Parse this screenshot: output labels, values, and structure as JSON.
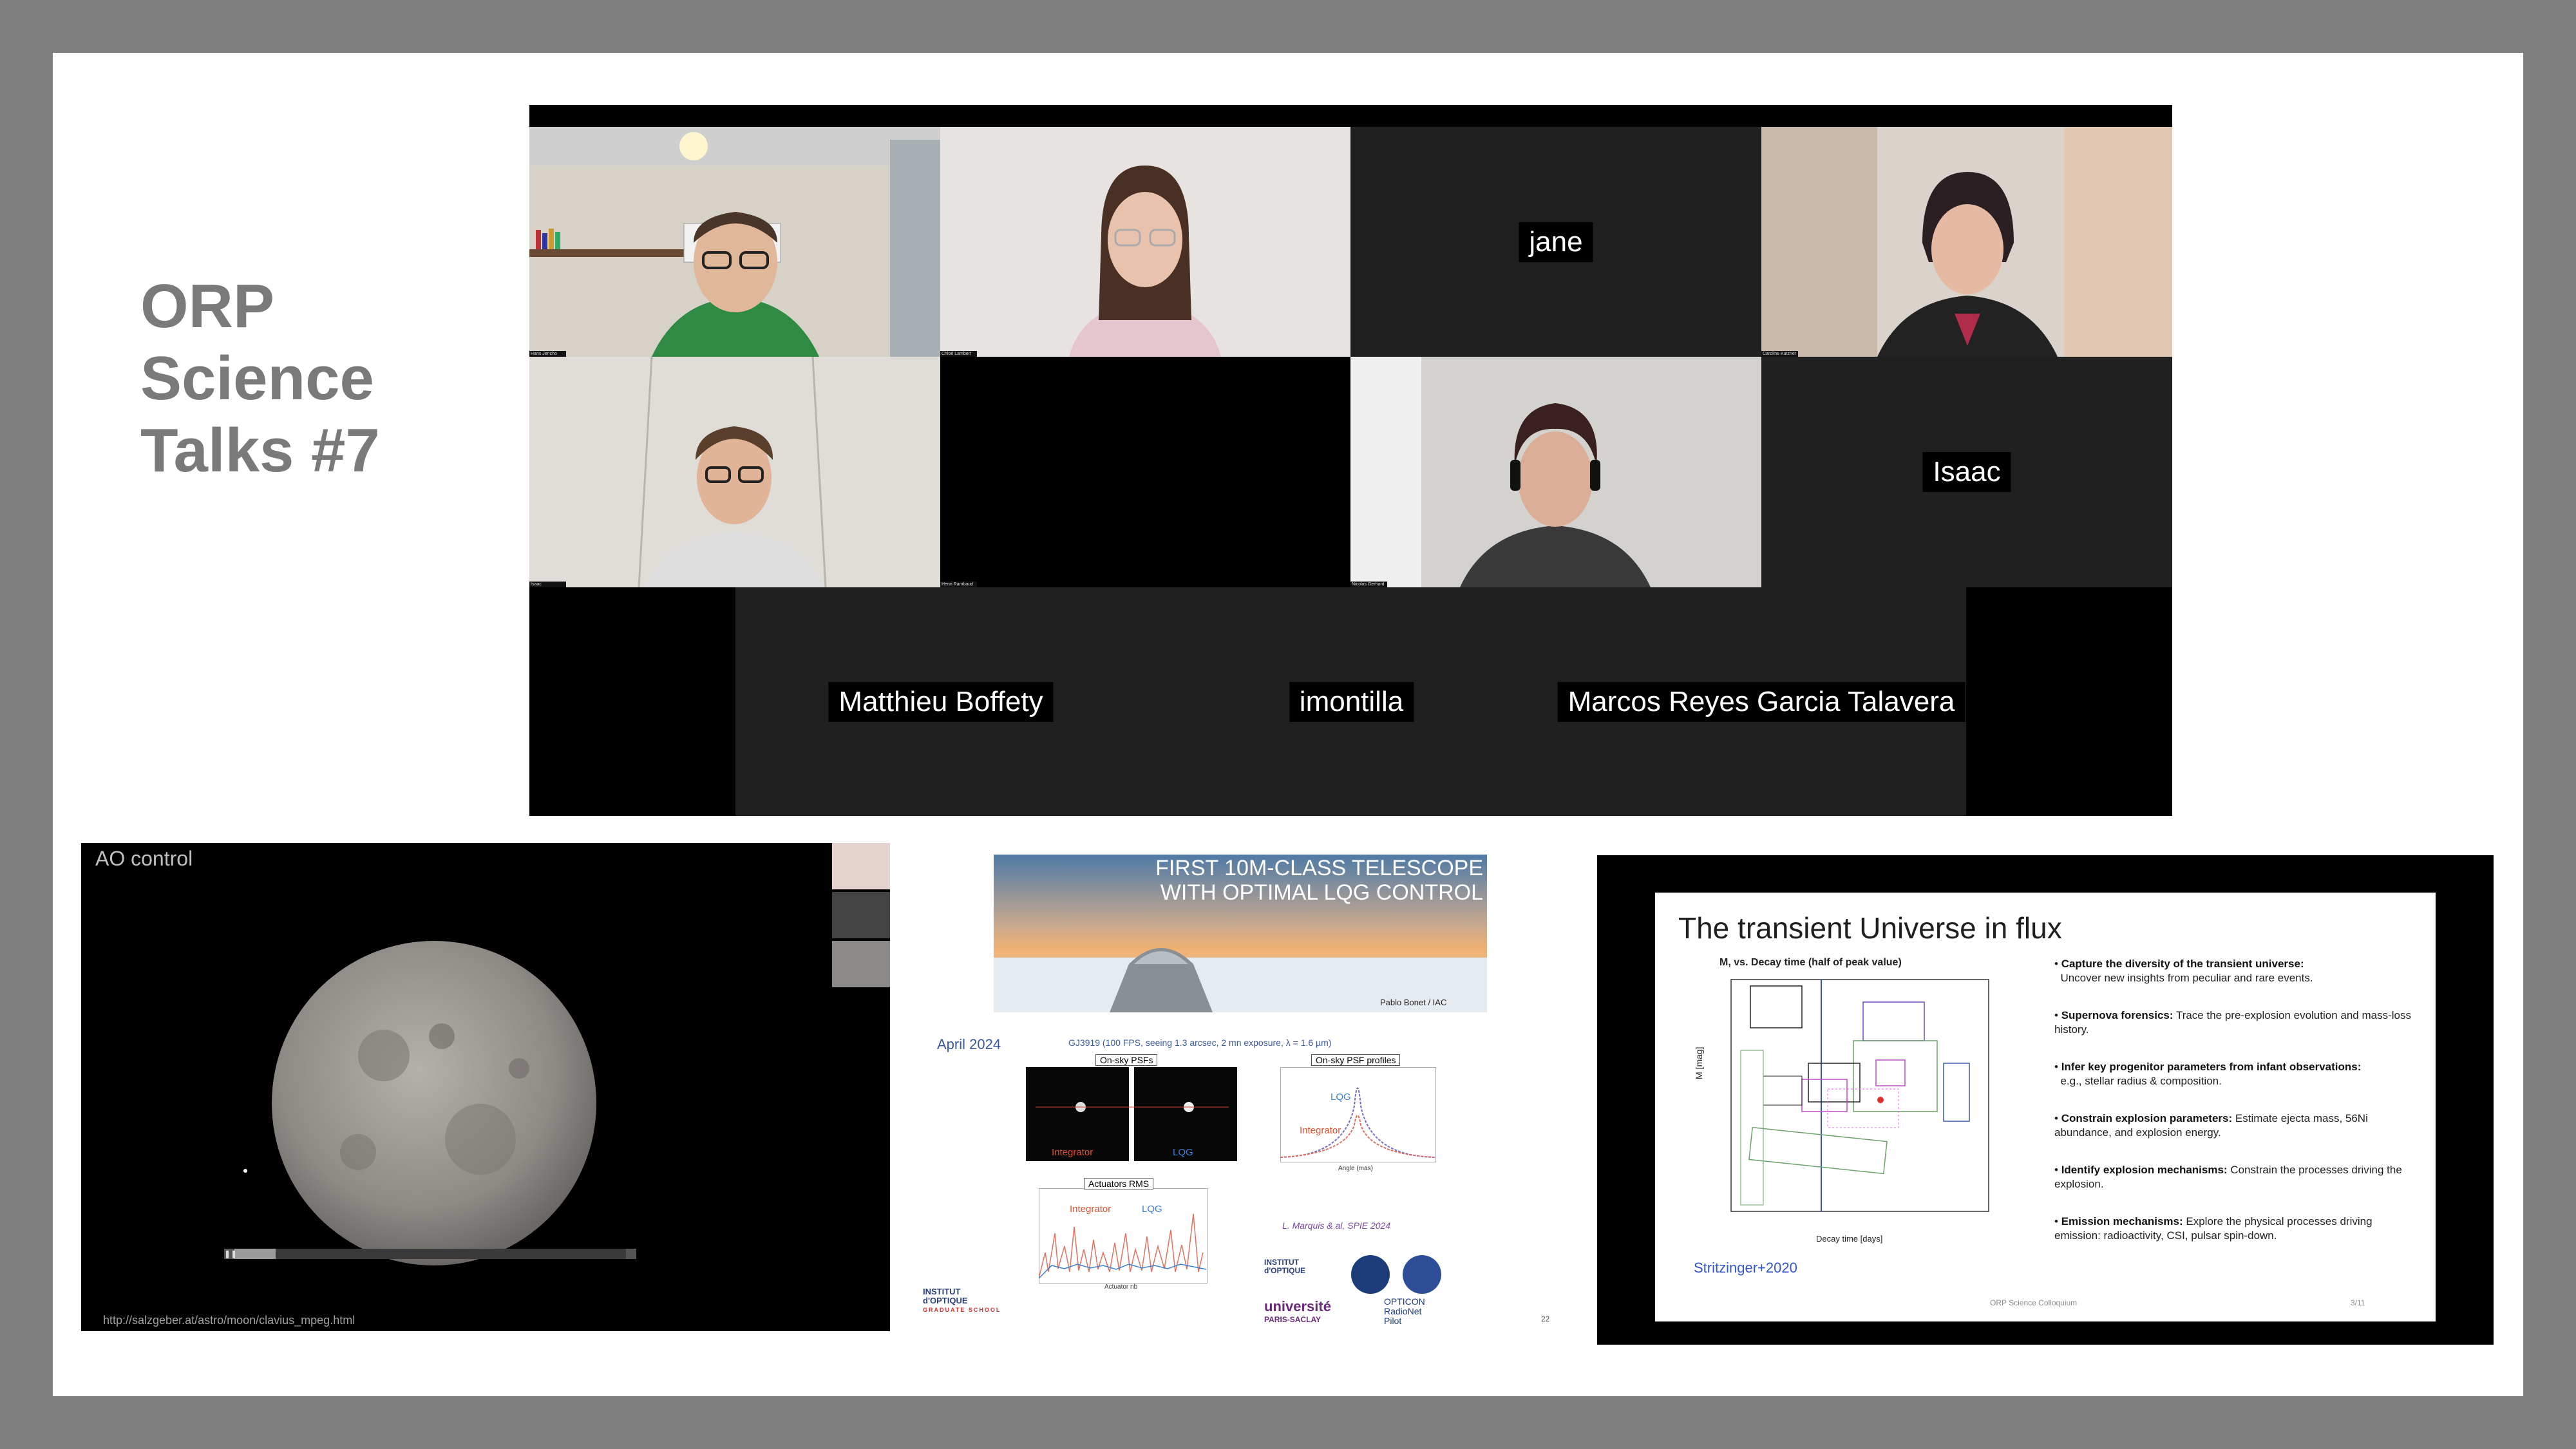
{
  "slide_title": [
    "ORP",
    "Science",
    "Talks #7"
  ],
  "participants": {
    "video_tiles": [
      {
        "label": "Hans Jericho"
      },
      {
        "label": "Chloé Lambert"
      },
      {
        "label": "Caroline Kutzner"
      },
      {
        "label": "Isaac"
      },
      {
        "label": "Henri Rambaud"
      },
      {
        "label": "Nicolas Gerhard"
      }
    ],
    "name_tiles": {
      "jane": "jane",
      "isaac": "Isaac",
      "matthieu": "Matthieu Boffety",
      "imontilla": "imontilla",
      "marcos": "Marcos Reyes Garcia Talavera"
    }
  },
  "ao_panel": {
    "title": "AO control",
    "url": "http://salzgeber.at/astro/moon/clavius_mpeg.html"
  },
  "slide2": {
    "banner_line1": "FIRST 10M-CLASS TELESCOPE",
    "banner_line2": "WITH OPTIMAL LQG CONTROL",
    "credit": "Pablo Bonet / IAC",
    "date": "April 2024",
    "obs": "GJ3919 (100 FPS, seeing 1.3 arcsec, 2 mn exposure, λ = 1.6 µm)",
    "psfs_label": "On-sky PSFs",
    "profiles_label": "On-sky PSF profiles",
    "integrator": "Integrator",
    "lqg": "LQG",
    "actuators_label": "Actuators RMS",
    "actuator_axis": "Actuator nb",
    "angle_axis": "Angle (mas)",
    "ref": "L. Marquis & al, SPIE 2024",
    "page": "22",
    "logo_io_1": "INSTITUT",
    "logo_io_2": "d'OPTIQUE",
    "logo_io_3": "GRADUATE SCHOOL",
    "logo_ups_1": "université",
    "logo_ups_2": "PARIS-SACLAY",
    "logo_opticon_1": "OPTICON",
    "logo_opticon_2": "RadioNet",
    "logo_opticon_3": "Pilot"
  },
  "slide3": {
    "title": "The transient Universe in flux",
    "plot_title": "M, vs. Decay time (half of peak value)",
    "y_axis": "M [mag]",
    "x_axis": "Decay time [days]",
    "citation": "Stritzinger+2020",
    "footer": "ORP Science Colloquium",
    "page": "3/11",
    "bullets": [
      {
        "head": "Capture the diversity of the transient universe:",
        "body": "Uncover new insights from peculiar and rare events."
      },
      {
        "head": "Supernova forensics:",
        "body": "Trace the pre-explosion evolution and mass-loss history."
      },
      {
        "head": "Infer key progenitor parameters from infant observations:",
        "body": "e.g., stellar radius & composition."
      },
      {
        "head": "Constrain explosion parameters:",
        "body": "Estimate ejecta mass, 56Ni abundance, and explosion energy."
      },
      {
        "head": "Identify explosion mechanisms:",
        "body": "Constrain the processes driving the explosion."
      },
      {
        "head": "Emission mechanisms:",
        "body": "Explore the physical processes driving emission: radioactivity, CSI, pulsar spin-down."
      }
    ]
  }
}
